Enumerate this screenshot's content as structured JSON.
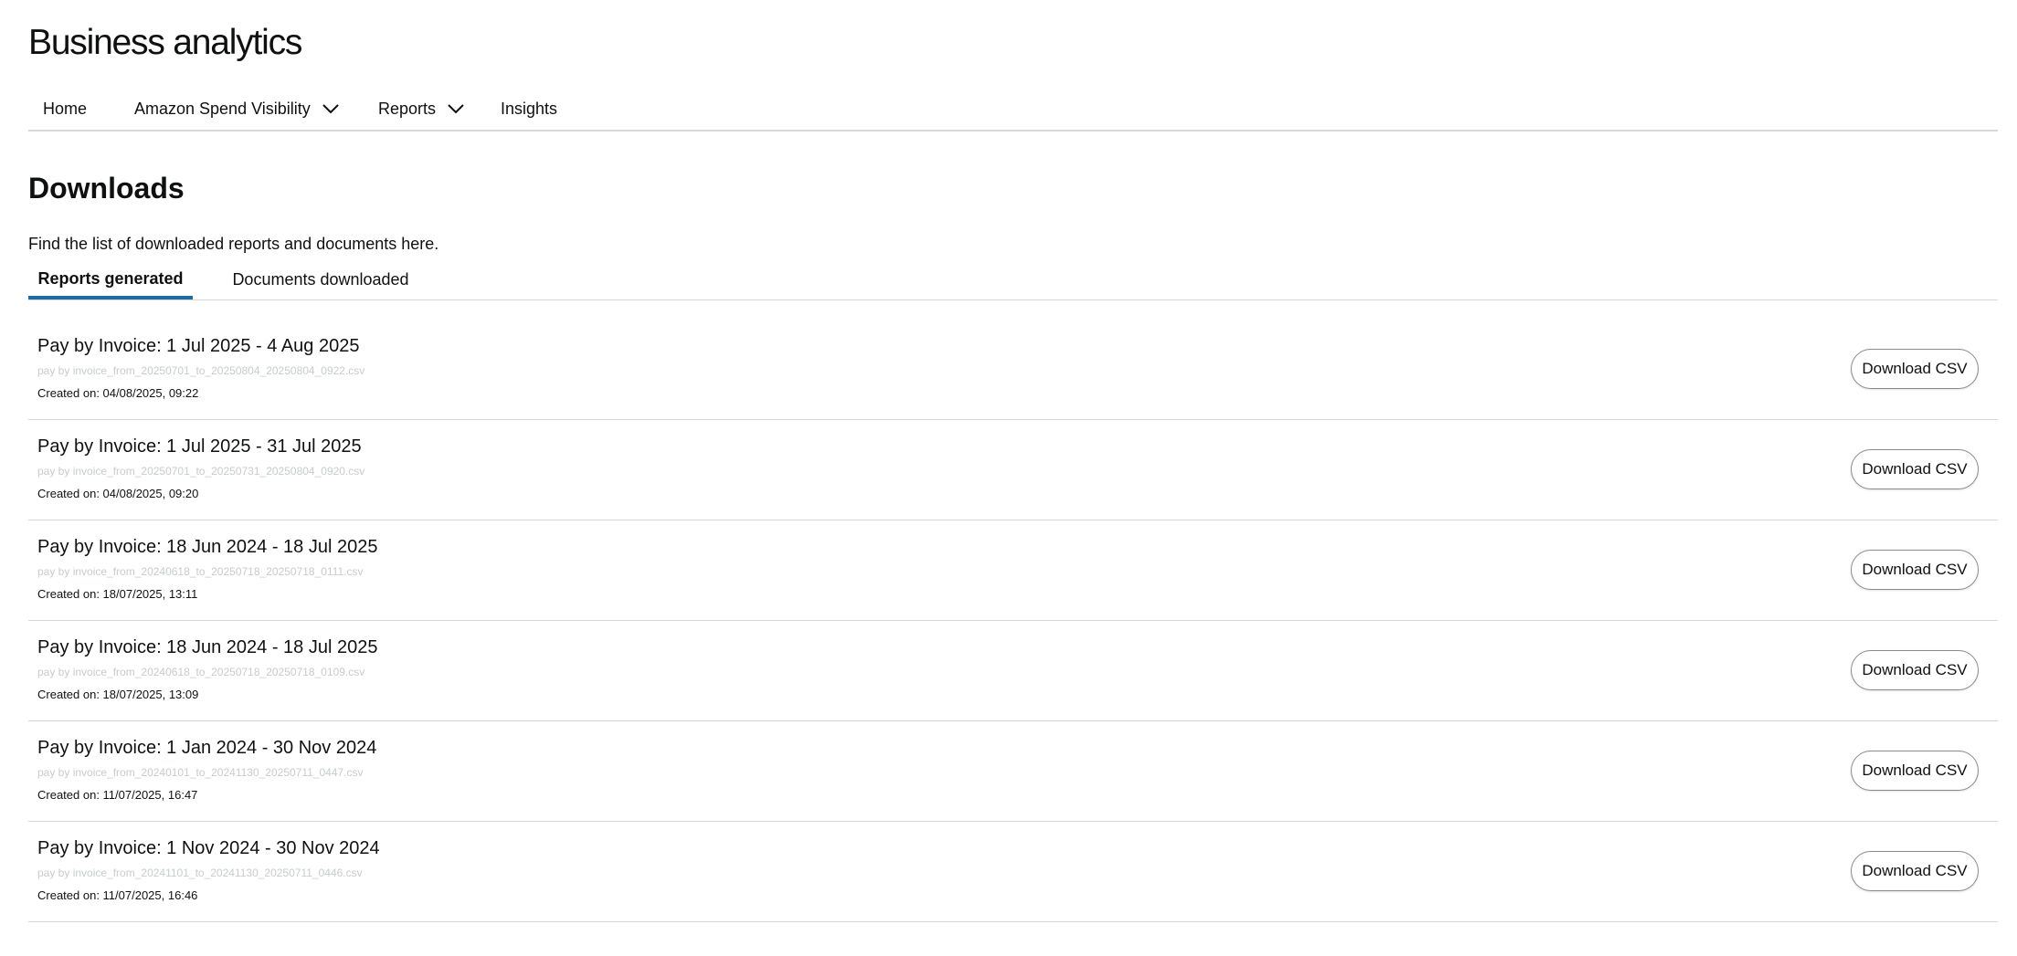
{
  "app": {
    "title": "Business analytics"
  },
  "nav": {
    "items": [
      {
        "label": "Home",
        "has_dropdown": false
      },
      {
        "label": "Amazon Spend Visibility",
        "has_dropdown": true
      },
      {
        "label": "Reports",
        "has_dropdown": true
      },
      {
        "label": "Insights",
        "has_dropdown": false
      }
    ],
    "dropdown_icon": "chevron-down-icon"
  },
  "downloads": {
    "title": "Downloads",
    "description": "Find the list of downloaded reports and documents here.",
    "tabs": [
      {
        "label": "Reports generated",
        "active": true
      },
      {
        "label": "Documents downloaded",
        "active": false
      }
    ],
    "download_button_label": "Download CSV",
    "reports": [
      {
        "title": "Pay by Invoice: 1 Jul 2025 - 4 Aug 2025",
        "filename": "pay by invoice_from_20250701_to_20250804_20250804_0922.csv",
        "created": "Created on: 04/08/2025, 09:22"
      },
      {
        "title": "Pay by Invoice: 1 Jul 2025 - 31 Jul 2025",
        "filename": "pay by invoice_from_20250701_to_20250731_20250804_0920.csv",
        "created": "Created on: 04/08/2025, 09:20"
      },
      {
        "title": "Pay by Invoice: 18 Jun 2024 - 18 Jul 2025",
        "filename": "pay by invoice_from_20240618_to_20250718_20250718_0111.csv",
        "created": "Created on: 18/07/2025, 13:11"
      },
      {
        "title": "Pay by Invoice: 18 Jun 2024 - 18 Jul 2025",
        "filename": "pay by invoice_from_20240618_to_20250718_20250718_0109.csv",
        "created": "Created on: 18/07/2025, 13:09"
      },
      {
        "title": "Pay by Invoice: 1 Jan 2024 - 30 Nov 2024",
        "filename": "pay by invoice_from_20240101_to_20241130_20250711_0447.csv",
        "created": "Created on: 11/07/2025, 16:47"
      },
      {
        "title": "Pay by Invoice: 1 Nov 2024 - 30 Nov 2024",
        "filename": "pay by invoice_from_20241101_to_20241130_20250711_0446.csv",
        "created": "Created on: 11/07/2025, 16:46"
      }
    ]
  },
  "colors": {
    "text": "#0f1111",
    "active_tab_underline": "#1b6ca8",
    "divider": "#d5d9d9",
    "filename_text": "#c7cccc"
  }
}
